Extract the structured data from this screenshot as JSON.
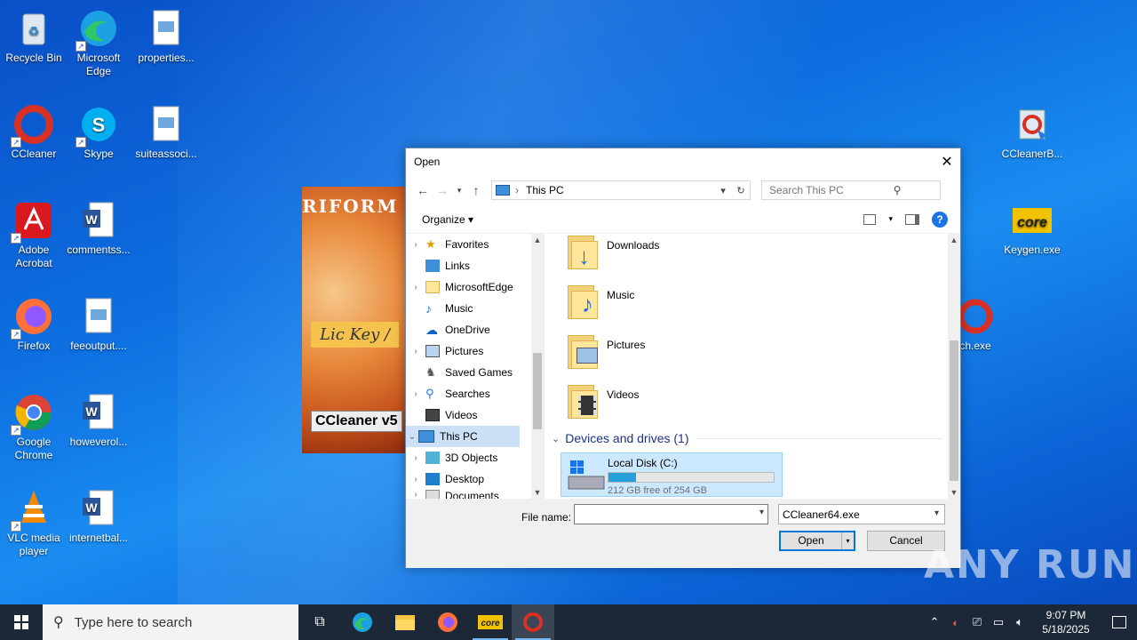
{
  "desktop": {
    "icons": [
      {
        "label": "Recycle Bin",
        "icon": "recycle-bin-icon"
      },
      {
        "label": "Microsoft Edge",
        "icon": "edge-icon"
      },
      {
        "label": "properties...",
        "icon": "image-file-icon"
      },
      {
        "label": "CCleaner",
        "icon": "ccleaner-icon"
      },
      {
        "label": "Skype",
        "icon": "skype-icon"
      },
      {
        "label": "suiteassoci...",
        "icon": "image-file-icon"
      },
      {
        "label": "Adobe Acrobat",
        "icon": "acrobat-icon"
      },
      {
        "label": "commentss...",
        "icon": "word-doc-icon"
      },
      {
        "label": "Firefox",
        "icon": "firefox-icon"
      },
      {
        "label": "feeoutput....",
        "icon": "image-file-icon"
      },
      {
        "label": "Google Chrome",
        "icon": "chrome-icon"
      },
      {
        "label": "howeverol...",
        "icon": "word-doc-icon"
      },
      {
        "label": "VLC media player",
        "icon": "vlc-icon"
      },
      {
        "label": "internetbal...",
        "icon": "word-doc-icon"
      },
      {
        "label": "CCleanerB...",
        "icon": "installer-icon"
      },
      {
        "label": "Keygen.exe",
        "icon": "keygen-icon"
      },
      {
        "label": "ch.exe",
        "icon": "ccleaner-icon"
      }
    ],
    "background_window": {
      "banner": "RIFORM M",
      "lic_key": "Lic Key /",
      "product": "CCleaner v5"
    },
    "watermark": "ANY RUN"
  },
  "dialog": {
    "title": "Open",
    "address": {
      "crumb": "This PC",
      "search_placeholder": "Search This PC"
    },
    "toolbar": {
      "organize_label": "Organize ▾"
    },
    "nav_items": [
      {
        "label": "Favorites",
        "icon": "star-icon"
      },
      {
        "label": "Links",
        "icon": "links-icon"
      },
      {
        "label": "MicrosoftEdge",
        "icon": "folder-icon"
      },
      {
        "label": "Music",
        "icon": "music-icon"
      },
      {
        "label": "OneDrive",
        "icon": "onedrive-icon"
      },
      {
        "label": "Pictures",
        "icon": "pictures-icon"
      },
      {
        "label": "Saved Games",
        "icon": "saved-games-icon"
      },
      {
        "label": "Searches",
        "icon": "search-icon"
      },
      {
        "label": "Videos",
        "icon": "videos-icon"
      },
      {
        "label": "This PC",
        "icon": "computer-icon"
      },
      {
        "label": "3D Objects",
        "icon": "cube-icon"
      },
      {
        "label": "Desktop",
        "icon": "desktop-icon"
      },
      {
        "label": "Documents",
        "icon": "documents-icon"
      }
    ],
    "folders": [
      {
        "label": "Downloads",
        "icon": "downloads-folder-icon"
      },
      {
        "label": "Music",
        "icon": "music-folder-icon"
      },
      {
        "label": "Pictures",
        "icon": "pictures-folder-icon"
      },
      {
        "label": "Videos",
        "icon": "videos-folder-icon"
      }
    ],
    "devices_group": "Devices and drives (1)",
    "drive": {
      "name": "Local Disk (C:)",
      "free_text": "212 GB free of 254 GB",
      "used_fraction": 0.165
    },
    "footer": {
      "filename_label": "File name:",
      "filename_value": "",
      "filetype_value": "CCleaner64.exe",
      "open_label": "Open",
      "cancel_label": "Cancel"
    }
  },
  "taskbar": {
    "search_placeholder": "Type here to search",
    "pinned": [
      "task-view-icon",
      "edge-icon",
      "file-explorer-icon",
      "firefox-icon",
      "keygen-icon",
      "ccleaner-icon"
    ],
    "time": "9:07 PM",
    "date": "5/18/2025"
  }
}
